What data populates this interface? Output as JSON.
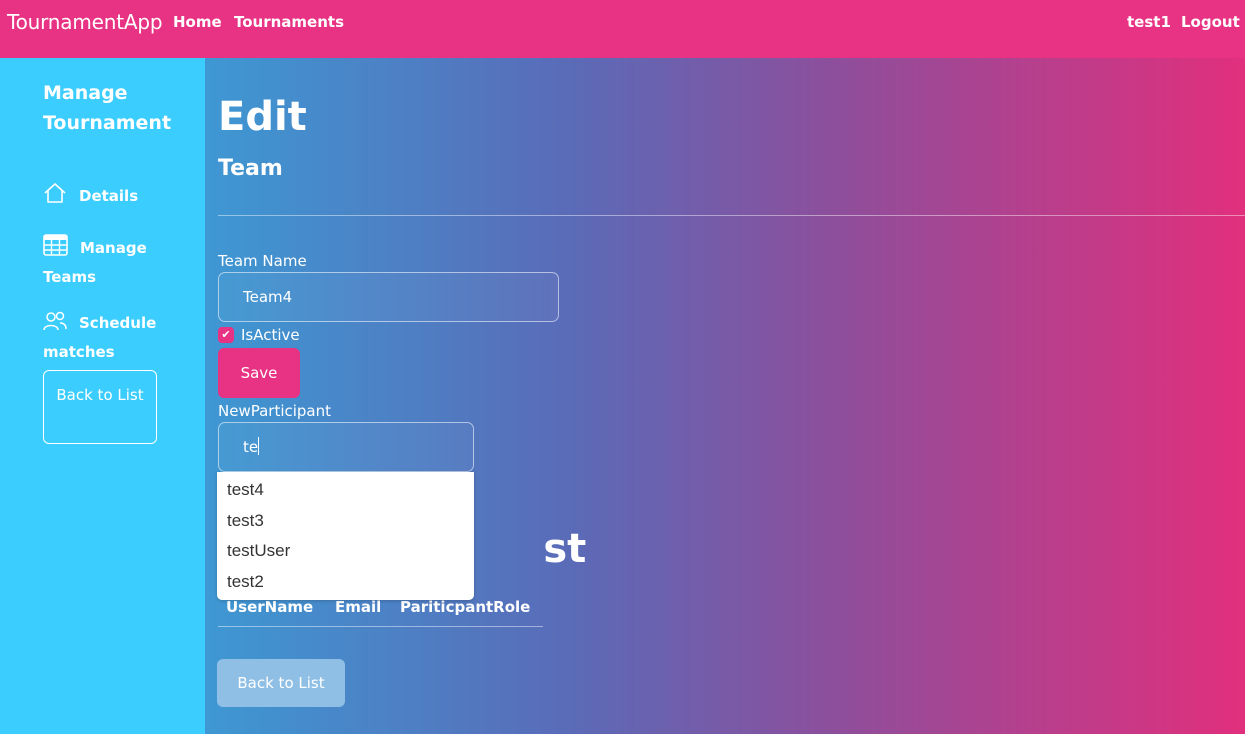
{
  "navbar": {
    "brand": "TournamentApp",
    "links": [
      "Home",
      "Tournaments"
    ],
    "user": "test1",
    "logout": "Logout"
  },
  "sidebar": {
    "title": "Manage Tournament",
    "items": [
      {
        "label": "Details",
        "icon": "home-icon"
      },
      {
        "label": "Manage Teams",
        "icon": "table-icon"
      },
      {
        "label": "Schedule matches",
        "icon": "people-icon"
      }
    ],
    "back": "Back to List"
  },
  "main": {
    "heading": "Edit",
    "subheading": "Team",
    "team_name_label": "Team Name",
    "team_name_value": "Team4",
    "is_active_label": "IsActive",
    "is_active_checked": true,
    "save_label": "Save",
    "new_participant_label": "NewParticipant",
    "new_participant_value": "te",
    "list_heading_visible": "st",
    "columns": [
      "UserName",
      "Email",
      "PariticpantRole"
    ],
    "back_label": "Back to List"
  },
  "autocomplete": {
    "options": [
      "test4",
      "test3",
      "testUser",
      "test2"
    ]
  },
  "colors": {
    "navbar": "#e83283",
    "sidebar": "#3bcdfe",
    "accent": "#e83283"
  }
}
